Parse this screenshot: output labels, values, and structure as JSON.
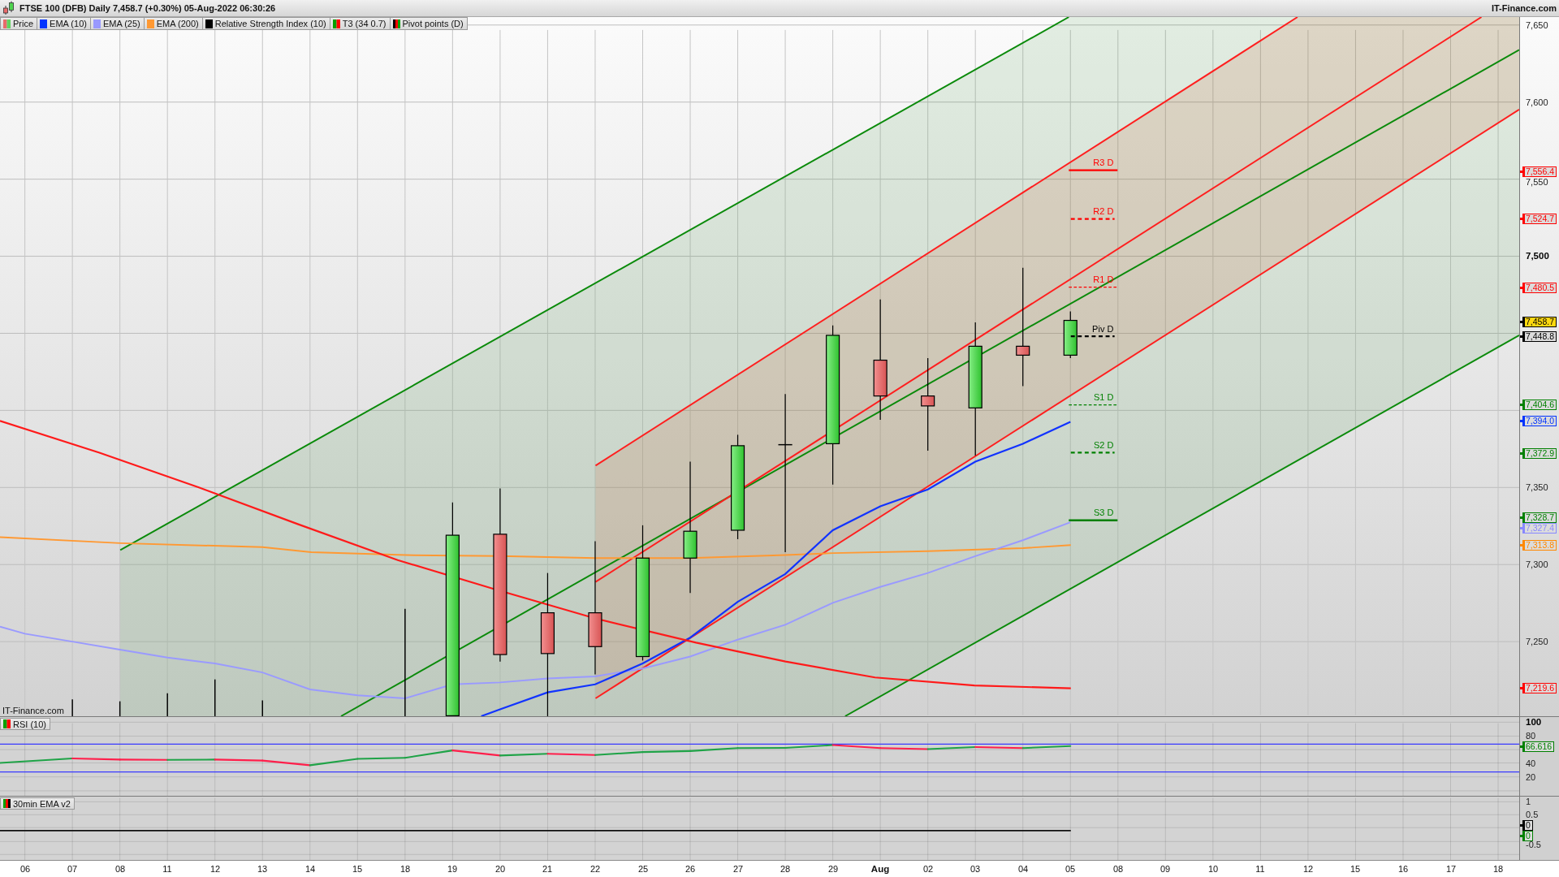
{
  "header": {
    "title": "FTSE 100 (DFB) Daily 7,458.7 (+0.30%) 05-Aug-2022 06:30:26",
    "site": "IT-Finance.com"
  },
  "legend": [
    {
      "label": "Price",
      "swatch": [
        {
          "color": "#e86a6a"
        },
        {
          "color": "#5fd35f"
        }
      ]
    },
    {
      "label": "EMA (10)",
      "swatch": [
        {
          "color": "#0033ff"
        }
      ]
    },
    {
      "label": "EMA (25)",
      "swatch": [
        {
          "color": "#9999ff"
        }
      ]
    },
    {
      "label": "EMA (200)",
      "swatch": [
        {
          "color": "#ff9933"
        }
      ]
    },
    {
      "label": "Relative Strength Index (10)",
      "swatch": [
        {
          "color": "#000000"
        }
      ]
    },
    {
      "label": "T3 (34 0.7)",
      "swatch": [
        {
          "color": "#00a000"
        },
        {
          "color": "#ff0000"
        }
      ]
    },
    {
      "label": "Pivot points (D)",
      "swatch": [
        {
          "color": "#000000"
        },
        {
          "color": "#ff0000"
        },
        {
          "color": "#00a000"
        }
      ]
    }
  ],
  "price_panel": {
    "site_label": "IT-Finance.com",
    "pivots": [
      {
        "label": "R3 D",
        "color": "#ff0000",
        "kind": "solid"
      },
      {
        "label": "R2 D",
        "color": "#ff0000",
        "kind": "dashed"
      },
      {
        "label": "R1 D",
        "color": "#ff0000",
        "kind": "dotted"
      },
      {
        "label": "Piv D",
        "color": "#000000",
        "kind": "dashed"
      },
      {
        "label": "S1 D",
        "color": "#008000",
        "kind": "dotted"
      },
      {
        "label": "S2 D",
        "color": "#008000",
        "kind": "dashed"
      },
      {
        "label": "S3 D",
        "color": "#008000",
        "kind": "solid"
      }
    ],
    "axis_labels": [
      {
        "text": "7,650",
        "bold": false
      },
      {
        "text": "7,600",
        "bold": false
      },
      {
        "text": "7,550",
        "bold": false
      },
      {
        "text": "7,500",
        "bold": true
      },
      {
        "text": "7,350",
        "bold": false
      },
      {
        "text": "7,300",
        "bold": false
      },
      {
        "text": "7,250",
        "bold": false
      }
    ],
    "price_tags": [
      {
        "text": "7,556.4",
        "color": "#ff0000",
        "kind": "level"
      },
      {
        "text": "7,524.7",
        "color": "#ff0000",
        "kind": "level"
      },
      {
        "text": "7,480.5",
        "color": "#ff0000",
        "kind": "level"
      },
      {
        "text": "7,458.7",
        "color": "#000000",
        "kind": "last"
      },
      {
        "text": "7,448.8",
        "color": "#000000",
        "kind": "level"
      },
      {
        "text": "7,404.6",
        "color": "#008000",
        "kind": "level"
      },
      {
        "text": "7,394.0",
        "color": "#0033ff",
        "kind": "level"
      },
      {
        "text": "7,372.9",
        "color": "#008000",
        "kind": "level"
      },
      {
        "text": "7,328.7",
        "color": "#008000",
        "kind": "level"
      },
      {
        "text": "7,327.4",
        "color": "#8888ff",
        "kind": "level"
      },
      {
        "text": "7,313.8",
        "color": "#ff8800",
        "kind": "level"
      },
      {
        "text": "7,219.6",
        "color": "#ff0000",
        "kind": "level"
      }
    ]
  },
  "rsi_panel": {
    "label": "RSI (10)",
    "swatch": [
      {
        "color": "#00a000"
      },
      {
        "color": "#ff0000"
      }
    ],
    "axis_labels": [
      {
        "text": "100",
        "bold": true
      },
      {
        "text": "80",
        "bold": false
      },
      {
        "text": "40",
        "bold": false
      },
      {
        "text": "20",
        "bold": false
      }
    ],
    "price_tags": [
      {
        "text": "66.616",
        "color": "#008000",
        "kind": "level"
      }
    ]
  },
  "ema_panel": {
    "label": "30min EMA v2",
    "swatch": [
      {
        "color": "#00a000"
      },
      {
        "color": "#ff0000"
      },
      {
        "color": "#000000"
      }
    ],
    "axis_labels": [
      {
        "text": "1",
        "bold": false
      },
      {
        "text": "0.5",
        "bold": false
      },
      {
        "text": "-0.5",
        "bold": false
      }
    ],
    "price_tags": [
      {
        "text": "0",
        "color": "#000000",
        "kind": "level"
      },
      {
        "text": "0",
        "color": "#008000",
        "kind": "level"
      }
    ]
  },
  "date_axis": [
    {
      "text": "06",
      "bold": false
    },
    {
      "text": "07",
      "bold": false
    },
    {
      "text": "08",
      "bold": false
    },
    {
      "text": "11",
      "bold": false
    },
    {
      "text": "12",
      "bold": false
    },
    {
      "text": "13",
      "bold": false
    },
    {
      "text": "14",
      "bold": false
    },
    {
      "text": "15",
      "bold": false
    },
    {
      "text": "18",
      "bold": false
    },
    {
      "text": "19",
      "bold": false
    },
    {
      "text": "20",
      "bold": false
    },
    {
      "text": "21",
      "bold": false
    },
    {
      "text": "22",
      "bold": false
    },
    {
      "text": "25",
      "bold": false
    },
    {
      "text": "26",
      "bold": false
    },
    {
      "text": "27",
      "bold": false
    },
    {
      "text": "28",
      "bold": false
    },
    {
      "text": "29",
      "bold": false
    },
    {
      "text": "Aug",
      "bold": true
    },
    {
      "text": "02",
      "bold": false
    },
    {
      "text": "03",
      "bold": false
    },
    {
      "text": "04",
      "bold": false
    },
    {
      "text": "05",
      "bold": false
    },
    {
      "text": "08",
      "bold": false
    },
    {
      "text": "09",
      "bold": false
    },
    {
      "text": "10",
      "bold": false
    },
    {
      "text": "11",
      "bold": false
    },
    {
      "text": "12",
      "bold": false
    },
    {
      "text": "15",
      "bold": false
    },
    {
      "text": "16",
      "bold": false
    },
    {
      "text": "17",
      "bold": false
    },
    {
      "text": "18",
      "bold": false
    }
  ]
}
